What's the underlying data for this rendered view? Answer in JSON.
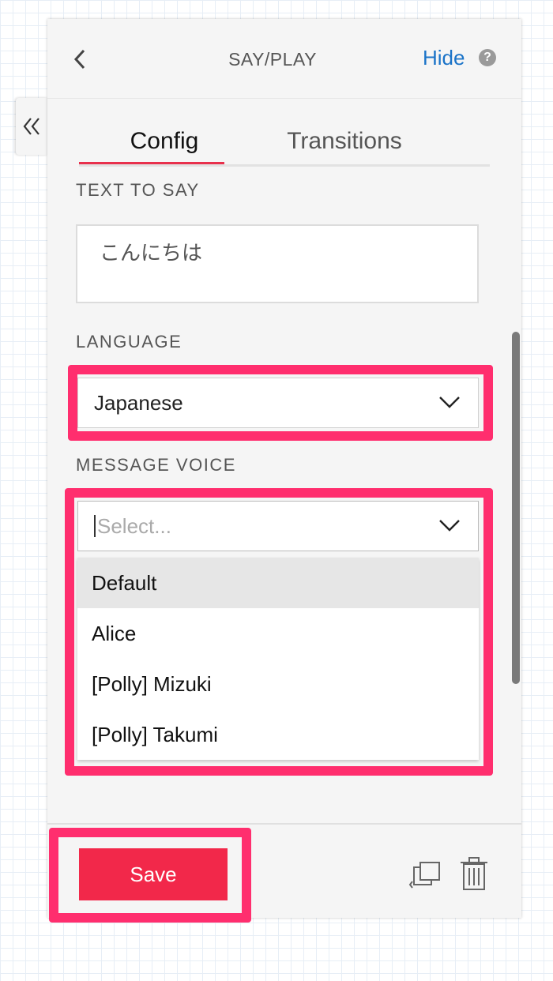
{
  "header": {
    "title": "SAY/PLAY",
    "hide_label": "Hide",
    "help_symbol": "?"
  },
  "tabs": [
    {
      "label": "Config",
      "active": true
    },
    {
      "label": "Transitions",
      "active": false
    }
  ],
  "text_to_say": {
    "label": "TEXT TO SAY",
    "value": "こんにちは"
  },
  "language": {
    "label": "LANGUAGE",
    "selected": "Japanese"
  },
  "message_voice": {
    "label": "MESSAGE VOICE",
    "placeholder": "Select...",
    "options": [
      "Default",
      "Alice",
      "[Polly] Mizuki",
      "[Polly] Takumi"
    ],
    "focused_option": "Default"
  },
  "footer": {
    "save_label": "Save"
  },
  "icons": {
    "collapse": "double-chevron-left-icon",
    "back": "chevron-left-icon",
    "help": "help-icon",
    "duplicate": "duplicate-icon",
    "delete": "trash-icon"
  },
  "colors": {
    "accent": "#f2284a",
    "highlight": "#ff2e6e",
    "link": "#1a73c8"
  }
}
